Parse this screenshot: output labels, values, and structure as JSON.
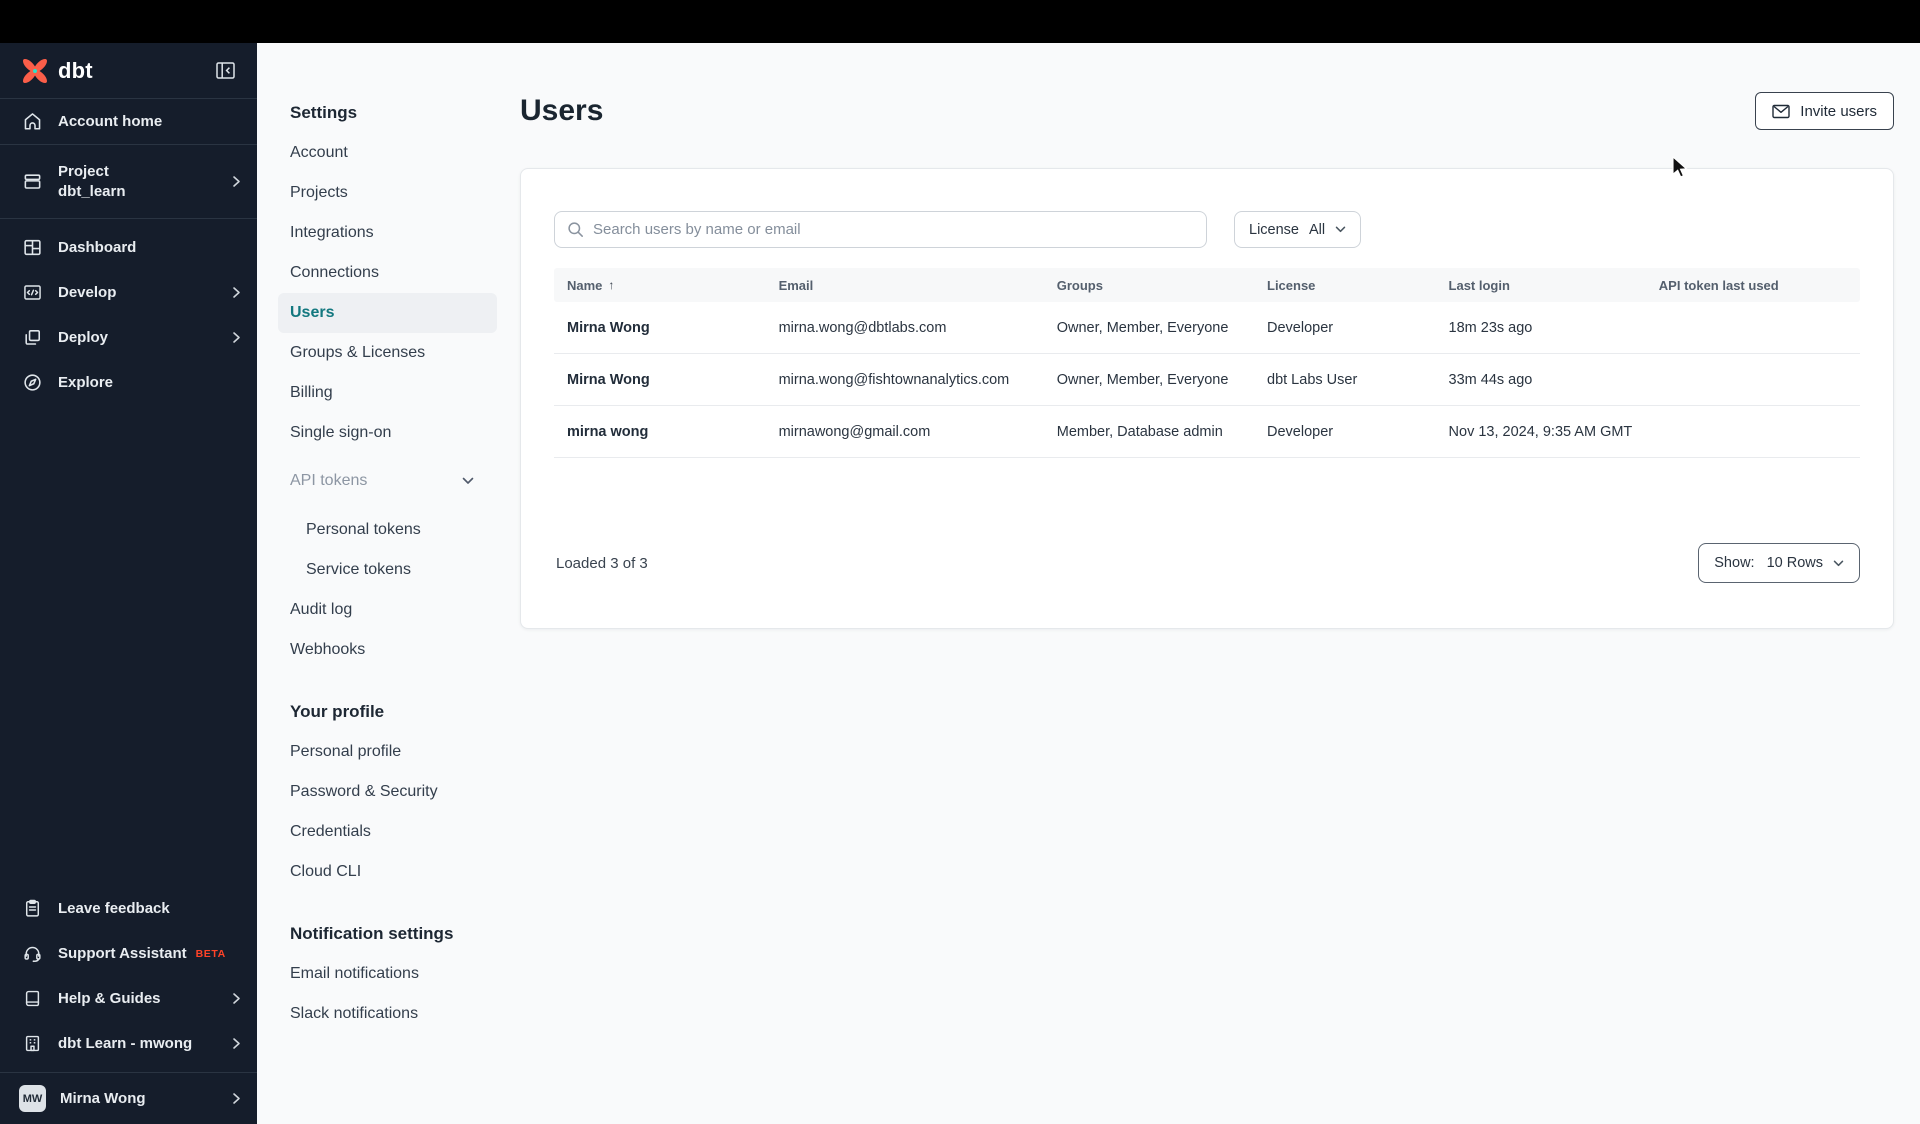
{
  "colors": {
    "sidebar_bg": "#151d2b",
    "topbar_bg": "#000000",
    "logo_orange": "#fb5e49",
    "beta_orange": "#ff4328",
    "selected_teal": "#13787f",
    "page_bg": "#f9fafb",
    "card_bg": "#ffffff"
  },
  "sidebar": {
    "logo_text": "dbt",
    "items": [
      {
        "label": "Account home"
      },
      {
        "label": "Project",
        "sublabel": "dbt_learn"
      },
      {
        "label": "Dashboard"
      },
      {
        "label": "Develop"
      },
      {
        "label": "Deploy"
      },
      {
        "label": "Explore"
      }
    ],
    "footer_items": [
      {
        "label": "Leave feedback"
      },
      {
        "label": "Support Assistant",
        "badge": "BETA"
      },
      {
        "label": "Help & Guides"
      },
      {
        "label": "dbt Learn - mwong"
      }
    ],
    "user": {
      "initials": "MW",
      "name": "Mirna Wong"
    }
  },
  "settings_nav": {
    "heading": "Settings",
    "items": [
      {
        "label": "Account"
      },
      {
        "label": "Projects"
      },
      {
        "label": "Integrations"
      },
      {
        "label": "Connections"
      },
      {
        "label": "Users"
      },
      {
        "label": "Groups & Licenses"
      },
      {
        "label": "Billing"
      },
      {
        "label": "Single sign-on"
      },
      {
        "label": "API tokens"
      },
      {
        "label": "Personal tokens"
      },
      {
        "label": "Service tokens"
      },
      {
        "label": "Audit log"
      },
      {
        "label": "Webhooks"
      }
    ],
    "profile_heading": "Your profile",
    "profile_items": [
      {
        "label": "Personal profile"
      },
      {
        "label": "Password & Security"
      },
      {
        "label": "Credentials"
      },
      {
        "label": "Cloud CLI"
      }
    ],
    "notifications_heading": "Notification settings",
    "notification_items": [
      {
        "label": "Email notifications"
      },
      {
        "label": "Slack notifications"
      }
    ]
  },
  "main": {
    "title": "Users",
    "invite_button": "Invite users",
    "search_placeholder": "Search users by name or email",
    "license_filter": {
      "label": "License",
      "value": "All"
    },
    "table": {
      "columns": [
        "Name",
        "Email",
        "Groups",
        "License",
        "Last login",
        "API token last used"
      ],
      "sort_indicator": "↑",
      "rows": [
        {
          "name": "Mirna Wong",
          "email": "mirna.wong@dbtlabs.com",
          "groups": "Owner, Member, Everyone",
          "license": "Developer",
          "last_login": "18m 23s ago",
          "api_token_last_used": ""
        },
        {
          "name": "Mirna Wong",
          "email": "mirna.wong@fishtownanalytics.com",
          "groups": "Owner, Member, Everyone",
          "license": "dbt Labs User",
          "last_login": "33m 44s ago",
          "api_token_last_used": ""
        },
        {
          "name": "mirna wong",
          "email": "mirnawong@gmail.com",
          "groups": "Member, Database admin",
          "license": "Developer",
          "last_login": "Nov 13, 2024, 9:35 AM GMT",
          "api_token_last_used": ""
        }
      ]
    },
    "footer": {
      "loaded_text": "Loaded 3 of 3",
      "show_label": "Show:",
      "show_value": "10 Rows"
    }
  }
}
